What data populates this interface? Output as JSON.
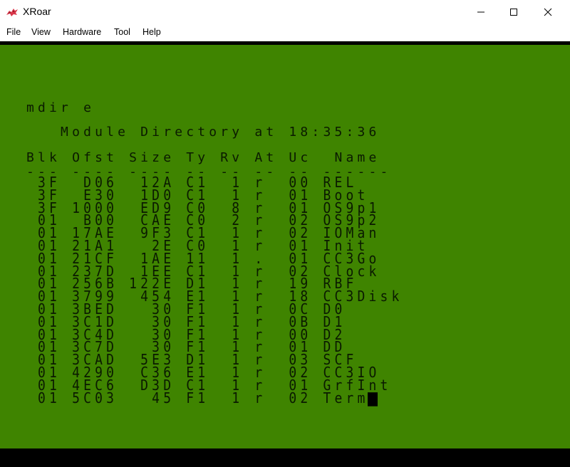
{
  "window": {
    "title": "XRoar",
    "controls": {
      "minimize": "—",
      "maximize": "☐",
      "close": "✕"
    },
    "icon": "xroar-dragon-icon"
  },
  "menubar": [
    "File",
    "View",
    "Hardware",
    "Tool",
    "Help"
  ],
  "terminal": {
    "command": "mdir e",
    "title": "   Module Directory at 18:35:36",
    "header": "Blk Ofst Size Ty Rv At Uc  Name",
    "separator": "--- ---- ---- -- -- -- -- ------",
    "rows": [
      " 3F  D06  12A C1  1 r  00 REL",
      " 3F  E30  1D0 C1  1 r  01 Boot",
      " 3F 1000  ED9 C0  8 r  01 OS9p1",
      " 01  B00  CAE C0  2 r  02 OS9p2",
      " 01 17AE  9F3 C1  1 r  02 IOMan",
      " 01 21A1   2E C0  1 r  01 Init",
      " 01 21CF  1AE 11  1 .  01 CC3Go",
      " 01 237D  1EE C1  1 r  02 Clock",
      " 01 256B 122E D1  1 r  19 RBF",
      " 01 3799  454 E1  1 r  18 CC3Disk",
      " 01 3BED   30 F1  1 r  0C D0",
      " 01 3C1D   30 F1  1 r  0B D1",
      " 01 3C4D   30 F1  1 r  00 D2",
      " 01 3C7D   30 F1  1 r  01 DD",
      " 01 3CAD  5E3 D1  1 r  03 SCF",
      " 01 4290  C36 E1  1 r  02 CC3IO",
      " 01 4EC6  D3D C1  1 r  01 GrfInt",
      " 01 5C03   45 F1  1 r  02 Term"
    ],
    "colors": {
      "background": "#3f8400",
      "text": "#0a1a00",
      "border": "#000000"
    }
  }
}
